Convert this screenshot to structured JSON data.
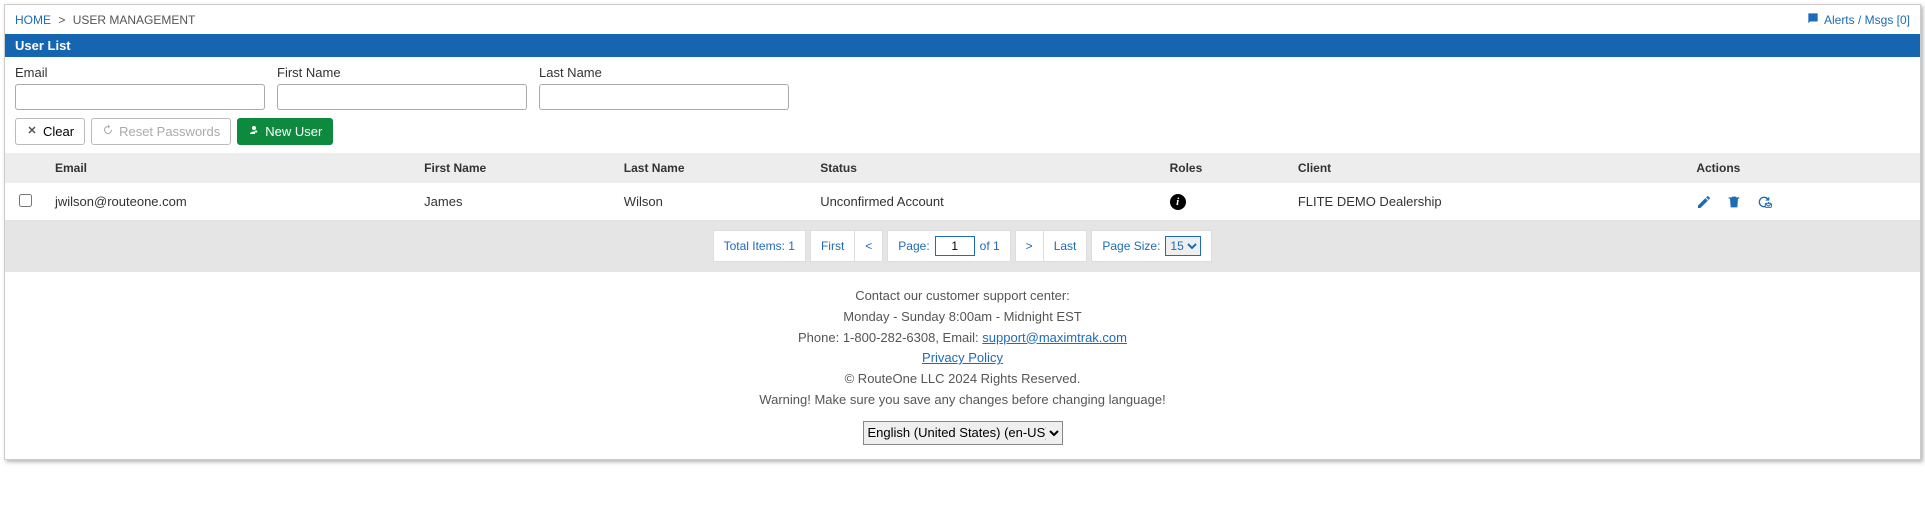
{
  "breadcrumb": {
    "home": "HOME",
    "sep": ">",
    "current": "USER MANAGEMENT"
  },
  "alerts": {
    "label": "Alerts / Msgs [0]"
  },
  "panel": {
    "title": "User List"
  },
  "filters": {
    "email_label": "Email",
    "first_label": "First Name",
    "last_label": "Last Name",
    "email_value": "",
    "first_value": "",
    "last_value": ""
  },
  "buttons": {
    "clear": "Clear",
    "reset": "Reset Passwords",
    "newuser": "New User"
  },
  "grid": {
    "headers": {
      "email": "Email",
      "first": "First Name",
      "last": "Last Name",
      "status": "Status",
      "roles": "Roles",
      "client": "Client",
      "actions": "Actions"
    },
    "rows": [
      {
        "email": "jwilson@routeone.com",
        "first": "James",
        "last": "Wilson",
        "status": "Unconfirmed Account",
        "client": "FLITE DEMO Dealership"
      }
    ]
  },
  "pager": {
    "total": "Total Items: 1",
    "first": "First",
    "prev": "<",
    "page_label": "Page:",
    "page_value": "1",
    "of_label": "of 1",
    "next": ">",
    "last": "Last",
    "size_label": "Page Size:",
    "size_value": "15"
  },
  "footer": {
    "l1": "Contact our customer support center:",
    "l2": "Monday - Sunday 8:00am - Midnight EST",
    "l3a": "Phone: 1-800-282-6308, Email: ",
    "l3b": "support@maximtrak.com",
    "l4": "Privacy Policy",
    "l5": "© RouteOne LLC 2024 Rights Reserved.",
    "l6": "Warning! Make sure you save any changes before changing language!",
    "lang": "English (United States) (en-US)"
  }
}
